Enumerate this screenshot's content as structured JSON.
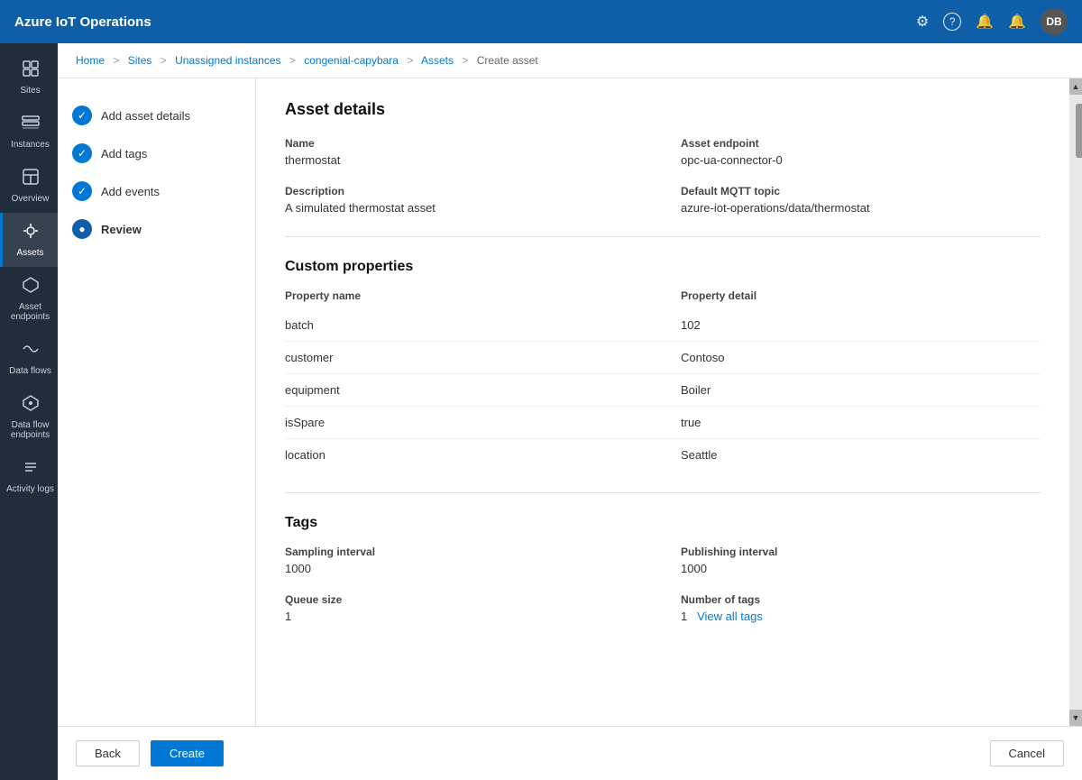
{
  "app": {
    "title": "Azure IoT Operations"
  },
  "topnav": {
    "icons": {
      "settings": "⚙",
      "help": "?",
      "bell_alert": "🔔",
      "bell_notify": "🔔"
    },
    "avatar": "DB"
  },
  "breadcrumb": {
    "items": [
      "Home",
      "Sites",
      "Unassigned instances",
      "congenial-capybara",
      "Assets",
      "Create asset"
    ],
    "separators": [
      ">",
      ">",
      ">",
      ">",
      ">"
    ]
  },
  "sidebar": {
    "items": [
      {
        "id": "sites",
        "label": "Sites",
        "icon": "⊞"
      },
      {
        "id": "instances",
        "label": "Instances",
        "icon": "▦"
      },
      {
        "id": "overview",
        "label": "Overview",
        "icon": "◫"
      },
      {
        "id": "assets",
        "label": "Assets",
        "icon": "◈",
        "active": true
      },
      {
        "id": "asset-endpoints",
        "label": "Asset endpoints",
        "icon": "⬡"
      },
      {
        "id": "data-flows",
        "label": "Data flows",
        "icon": "⇄"
      },
      {
        "id": "data-flow-endpoints",
        "label": "Data flow endpoints",
        "icon": "⬡"
      },
      {
        "id": "activity-logs",
        "label": "Activity logs",
        "icon": "☰"
      }
    ]
  },
  "steps": [
    {
      "id": "add-asset-details",
      "label": "Add asset details",
      "state": "completed"
    },
    {
      "id": "add-tags",
      "label": "Add tags",
      "state": "completed"
    },
    {
      "id": "add-events",
      "label": "Add events",
      "state": "completed"
    },
    {
      "id": "review",
      "label": "Review",
      "state": "active"
    }
  ],
  "asset_details": {
    "section_title": "Asset details",
    "name_label": "Name",
    "name_value": "thermostat",
    "endpoint_label": "Asset endpoint",
    "endpoint_value": "opc-ua-connector-0",
    "description_label": "Description",
    "description_value": "A simulated thermostat asset",
    "mqtt_label": "Default MQTT topic",
    "mqtt_value": "azure-iot-operations/data/thermostat"
  },
  "custom_properties": {
    "section_title": "Custom properties",
    "name_header": "Property name",
    "detail_header": "Property detail",
    "rows": [
      {
        "name": "batch",
        "value": "102"
      },
      {
        "name": "customer",
        "value": "Contoso"
      },
      {
        "name": "equipment",
        "value": "Boiler"
      },
      {
        "name": "isSpare",
        "value": "true"
      },
      {
        "name": "location",
        "value": "Seattle"
      }
    ]
  },
  "tags": {
    "section_title": "Tags",
    "sampling_interval_label": "Sampling interval",
    "sampling_interval_value": "1000",
    "publishing_interval_label": "Publishing interval",
    "publishing_interval_value": "1000",
    "queue_size_label": "Queue size",
    "queue_size_value": "1",
    "num_tags_label": "Number of tags",
    "num_tags_value": "1",
    "view_all_label": "View all tags"
  },
  "footer": {
    "back_label": "Back",
    "create_label": "Create",
    "cancel_label": "Cancel"
  }
}
